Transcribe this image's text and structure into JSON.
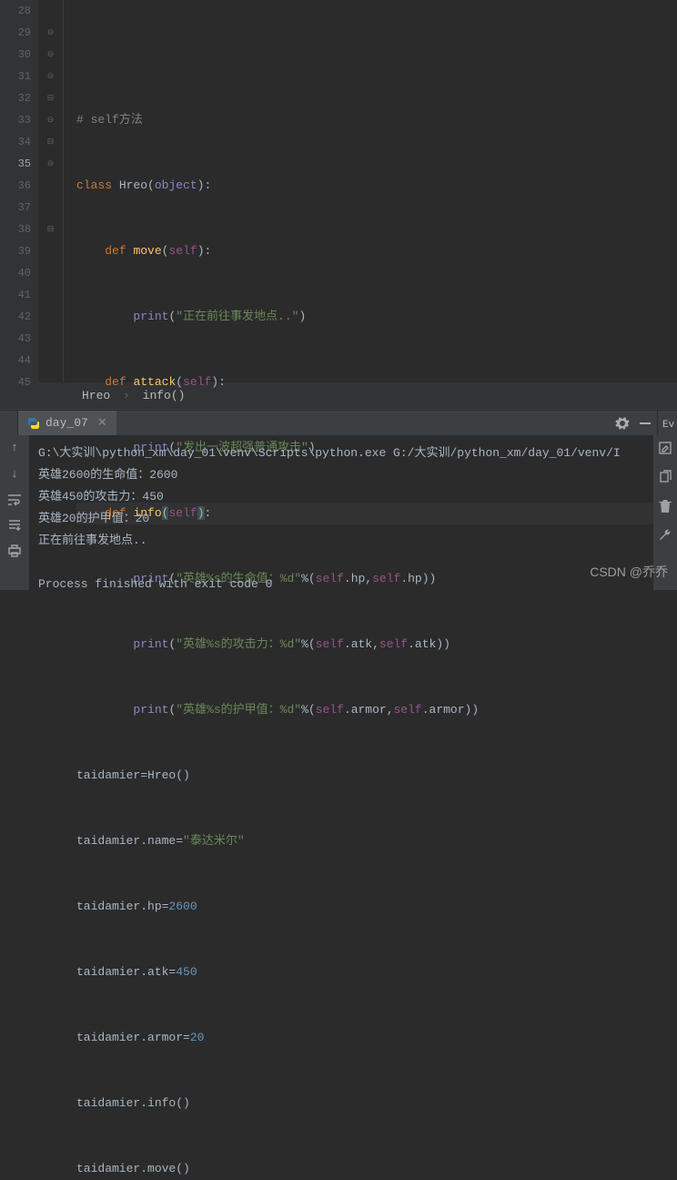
{
  "gutter": {
    "start": 28,
    "end": 45,
    "active": 35
  },
  "code": {
    "l28": "",
    "l29_comment": "# self方法",
    "l30_kw": "class ",
    "l30_name": "Hreo",
    "l30_p1": "(",
    "l30_obj": "object",
    "l30_p2": "):",
    "l31_def": "def ",
    "l31_fn": "move",
    "l31_p1": "(",
    "l31_self": "self",
    "l31_p2": "):",
    "l32_print": "print",
    "l32_p1": "(",
    "l32_str": "\"正在前往事发地点..\"",
    "l32_p2": ")",
    "l33_def": "def ",
    "l33_fn": "attack",
    "l33_p1": "(",
    "l33_self": "self",
    "l33_p2": "):",
    "l34_print": "print",
    "l34_p1": "(",
    "l34_str": "\"发出一波超强普通攻击\"",
    "l34_p2": ")",
    "l35_def": "def ",
    "l35_fn": "info",
    "l35_p1": "(",
    "l35_self": "self",
    "l35_p2": ")",
    "l35_colon": ":",
    "l36_print": "print",
    "l36_p1": "(",
    "l36_str": "\"英雄%s的生命值：%d\"",
    "l36_pct": "%(",
    "l36_s1": "self",
    "l36_d1": ".hp,",
    "l36_s2": "self",
    "l36_d2": ".hp))",
    "l37_print": "print",
    "l37_p1": "(",
    "l37_str": "\"英雄%s的攻击力：%d\"",
    "l37_pct": "%(",
    "l37_s1": "self",
    "l37_d1": ".atk,",
    "l37_s2": "self",
    "l37_d2": ".atk))",
    "l38_print": "print",
    "l38_p1": "(",
    "l38_str": "\"英雄%s的护甲值：%d\"",
    "l38_pct": "%(",
    "l38_s1": "self",
    "l38_d1": ".armor,",
    "l38_s2": "self",
    "l38_d2": ".armor))",
    "l39": "taidamier=Hreo()",
    "l40_a": "taidamier.name=",
    "l40_str": "\"泰达米尔\"",
    "l41_a": "taidamier.hp=",
    "l41_num": "2600",
    "l42_a": "taidamier.atk=",
    "l42_num": "450",
    "l43_a": "taidamier.armor=",
    "l43_num": "20",
    "l44": "taidamier.info()",
    "l45": "taidamier.move()"
  },
  "breadcrumb": {
    "cls": "Hreo",
    "sep": "›",
    "fn": "info()"
  },
  "tab": {
    "label": "day_07"
  },
  "console": {
    "path": "G:\\大实训\\python_xm\\day_01\\venv\\Scripts\\python.exe G:/大实训/python_xm/day_01/venv/I",
    "l1": "英雄2600的生命值：2600",
    "l2": "英雄450的攻击力：450",
    "l3": "英雄20的护甲值：20",
    "l4": "正在前往事发地点..",
    "exit": "Process finished with exit code 0"
  },
  "runtabs": {
    "ev": "Ev"
  },
  "watermark": "CSDN @乔乔"
}
